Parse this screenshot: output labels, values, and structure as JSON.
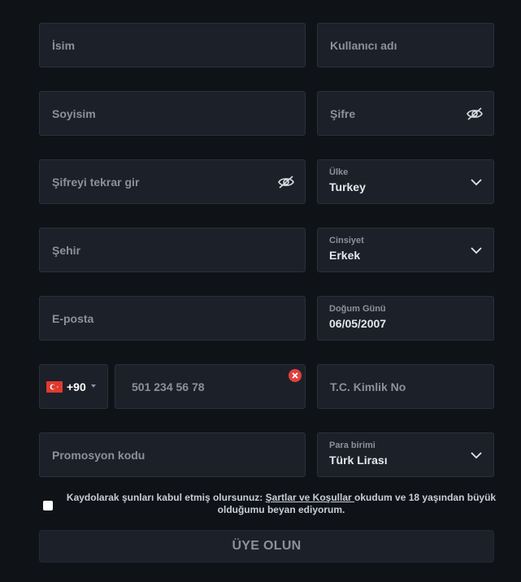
{
  "form": {
    "first_name": {
      "placeholder": "İsim"
    },
    "username": {
      "placeholder": "Kullanıcı adı"
    },
    "last_name": {
      "placeholder": "Soyisim"
    },
    "password": {
      "placeholder": "Şifre",
      "icon": "eye-slash-icon"
    },
    "password_repeat": {
      "placeholder": "Şifreyi tekrar gir",
      "icon": "eye-slash-icon"
    },
    "country": {
      "label": "Ülke",
      "value": "Turkey"
    },
    "city": {
      "placeholder": "Şehir"
    },
    "gender": {
      "label": "Cinsiyet",
      "value": "Erkek"
    },
    "email": {
      "placeholder": "E-posta"
    },
    "birthday": {
      "label": "Doğum Günü",
      "value": "06/05/2007"
    },
    "phone": {
      "dial_code": "+90",
      "placeholder": "501 234 56 78",
      "flag": "turkey-flag-icon",
      "clear_icon": "clear-icon"
    },
    "tc_id": {
      "placeholder": "T.C. Kimlik No"
    },
    "promo_code": {
      "placeholder": "Promosyon kodu"
    },
    "currency": {
      "label": "Para birimi",
      "value": "Türk Lirası"
    }
  },
  "terms": {
    "prefix": "Kaydolarak şunları kabul etmiş olursunuz: ",
    "link": "Şartlar ve Koşullar ",
    "suffix": "okudum ve 18 yaşından büyük olduğumu beyan ediyorum."
  },
  "submit_label": "ÜYE OLUN",
  "colors": {
    "background": "#0f1217",
    "field": "#1c2129",
    "muted_text": "#8b919b",
    "value_text": "#e4e7ec",
    "flag_red": "#e03a2f",
    "clear_red": "#e0403e"
  }
}
